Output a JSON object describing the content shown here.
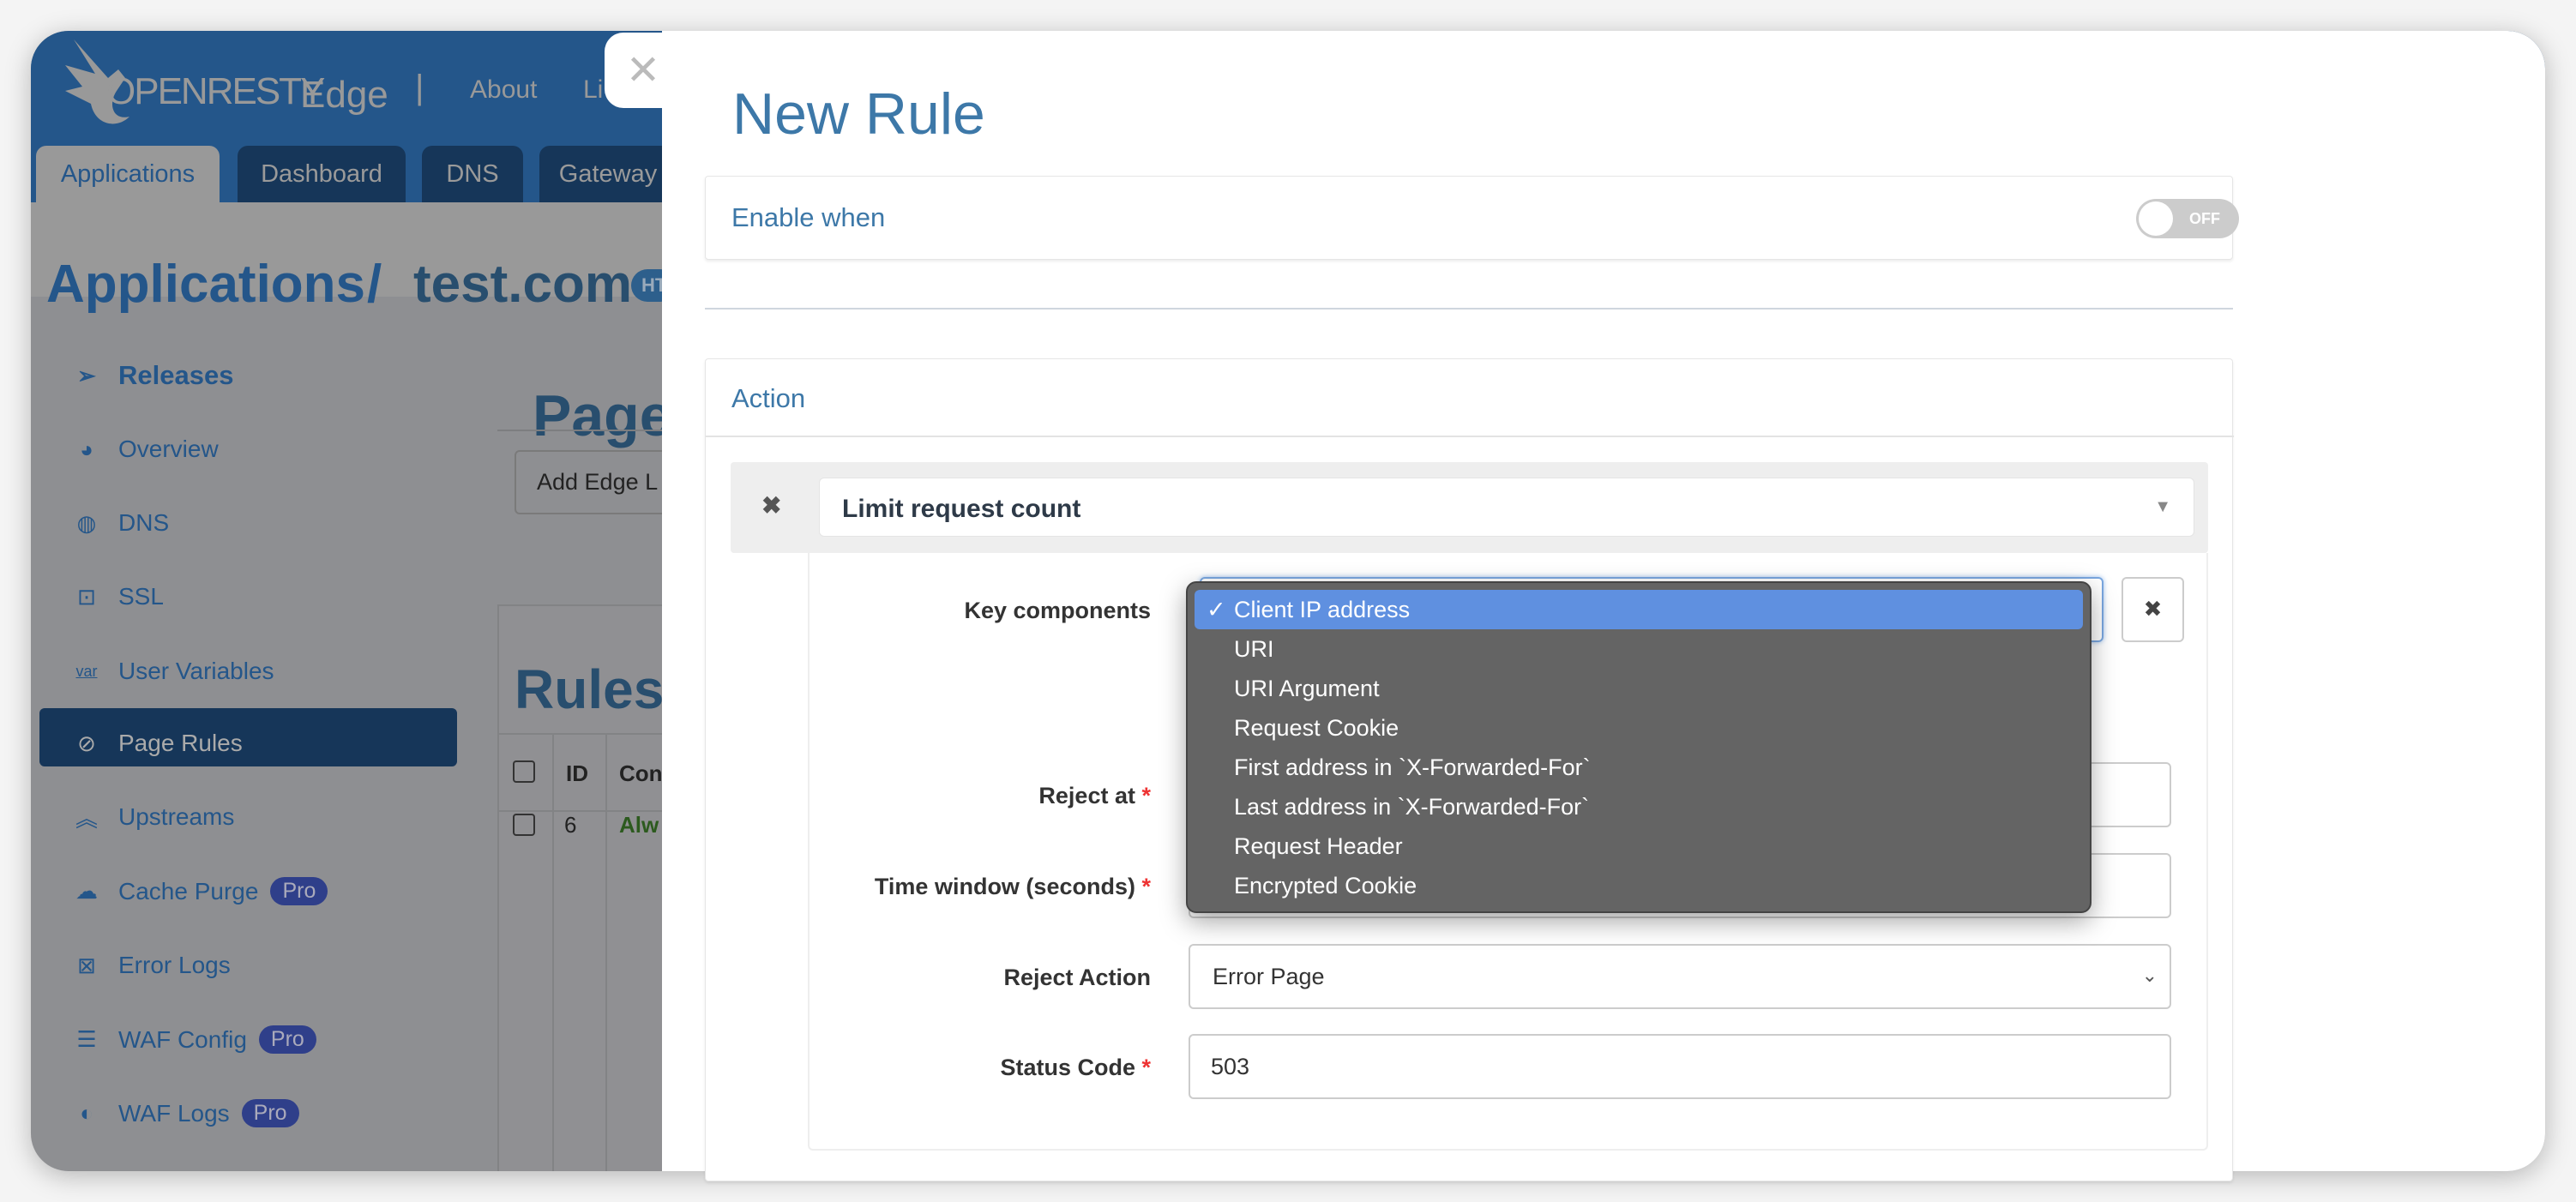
{
  "app": {
    "logo": "OPENRESTY",
    "product": "Edge",
    "nav_links": [
      "About",
      "Li"
    ]
  },
  "tabs": [
    {
      "label": "Applications",
      "active": true
    },
    {
      "label": "Dashboard"
    },
    {
      "label": "DNS"
    },
    {
      "label": "Gateway"
    }
  ],
  "breadcrumb": {
    "root": "Applications",
    "sep": "/",
    "app": "test.com",
    "badge": "HT"
  },
  "sidebar": {
    "items": [
      {
        "label": "Releases",
        "icon": "paper-plane-icon"
      },
      {
        "label": "Overview",
        "icon": "dashboard-icon"
      },
      {
        "label": "DNS",
        "icon": "dns-globe-icon"
      },
      {
        "label": "SSL",
        "icon": "lock-window-icon"
      },
      {
        "label": "User Variables",
        "icon": "var-icon"
      },
      {
        "label": "Page Rules",
        "icon": "page-rules-icon",
        "active": true
      },
      {
        "label": "Upstreams",
        "icon": "upstream-chevrons-icon"
      },
      {
        "label": "Cache Purge",
        "icon": "cache-icon",
        "badge": "Pro"
      },
      {
        "label": "Error Logs",
        "icon": "error-log-icon"
      },
      {
        "label": "WAF Config",
        "icon": "list-icon",
        "badge": "Pro"
      },
      {
        "label": "WAF Logs",
        "icon": "waf-logs-icon",
        "badge": "Pro"
      }
    ]
  },
  "main": {
    "title": "Page",
    "add_button": "Add Edge L",
    "rules_title": "Rules",
    "table": {
      "headers": [
        "ID",
        "Con"
      ],
      "rows": [
        {
          "id": "6",
          "condition": "Alw"
        }
      ]
    }
  },
  "modal": {
    "title": "New Rule",
    "enable_when": {
      "label": "Enable when",
      "toggle": "OFF",
      "enabled": false
    },
    "action": {
      "header": "Action",
      "selected_action": "Limit request count",
      "fields": {
        "key_components": {
          "label": "Key components",
          "value": "Client IP address"
        },
        "reject_at": {
          "label": "Reject at",
          "required": "*",
          "value": ""
        },
        "time_window": {
          "label": "Time window (seconds)",
          "required": "*",
          "value": ""
        },
        "reject_action": {
          "label": "Reject Action",
          "value": "Error Page"
        },
        "status_code": {
          "label": "Status Code",
          "required": "*",
          "value": "503"
        }
      }
    },
    "dropdown": {
      "check": "✓",
      "options": [
        "Client IP address",
        "URI",
        "URI Argument",
        "Request Cookie",
        "First address in `X-Forwarded-For`",
        "Last address in `X-Forwarded-For`",
        "Request Header",
        "Encrypted Cookie"
      ],
      "selected": "Client IP address"
    }
  },
  "colors": {
    "accent": "#3d78a8",
    "header": "#24568a",
    "selected_option": "#5f90e0",
    "dropdown_bg": "#646464"
  }
}
